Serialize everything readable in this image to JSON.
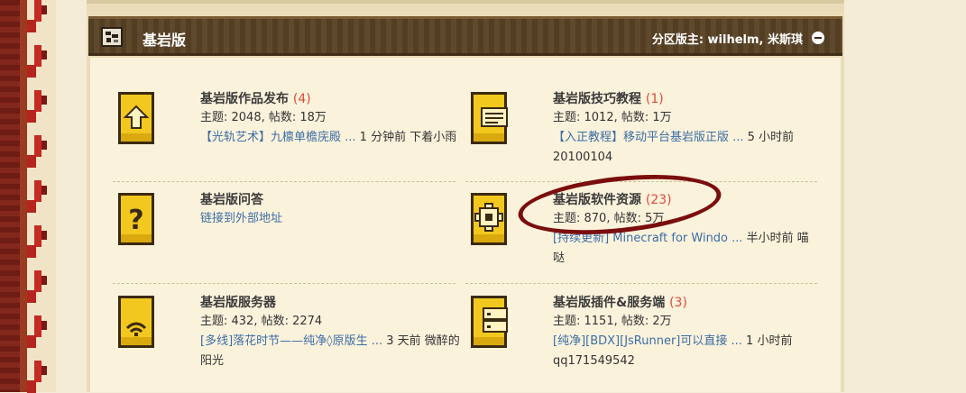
{
  "section": {
    "title": "基岩版",
    "moderators": "分区版主: wilhelm, 米斯琪"
  },
  "forums": [
    {
      "name": "基岩版作品发布",
      "count": "(4)",
      "stats": "主题: 2048, 帖数: 18万",
      "last_link": "【光轨艺术】九檩单檐庑殿 ...",
      "last_meta": " 1 分钟前 下着小雨",
      "icon": "upload-icon"
    },
    {
      "name": "基岩版技巧教程",
      "count": "(1)",
      "stats": "主题: 1012, 帖数: 1万",
      "last_link": "【入正教程】移动平台基岩版正版 ...",
      "last_meta": " 5 小时前 20100104",
      "icon": "message-icon"
    },
    {
      "name": "基岩版问答",
      "count": "",
      "stats": "",
      "last_link": "链接到外部地址",
      "last_meta": "",
      "icon": "question-icon"
    },
    {
      "name": "基岩版软件资源",
      "count": "(23)",
      "stats": "主题: 870, 帖数: 5万",
      "last_link": "[持续更新] Minecraft for Windo ...",
      "last_meta": " 半小时前 喵哒",
      "icon": "gear-icon"
    },
    {
      "name": "基岩版服务器",
      "count": "",
      "stats": "主题: 432, 帖数: 2274",
      "last_link": "[多线]落花时节——纯净◊原版生 ...",
      "last_meta": " 3 天前 微醉的阳光",
      "icon": "wifi-icon"
    },
    {
      "name": "基岩版插件&服务端",
      "count": "(3)",
      "stats": "主题: 1151, 帖数: 2万",
      "last_link": "[纯净][BDX][JsRunner]可以直接 ...",
      "last_meta": " 1 小时前 qq171549542",
      "icon": "server-icon"
    }
  ],
  "colors": {
    "header": "#5a4326",
    "accent_count": "#e04a3a",
    "link": "#3b6ea5",
    "icon_yellow": "#f2c81f",
    "annotation": "#7a0d0d"
  }
}
